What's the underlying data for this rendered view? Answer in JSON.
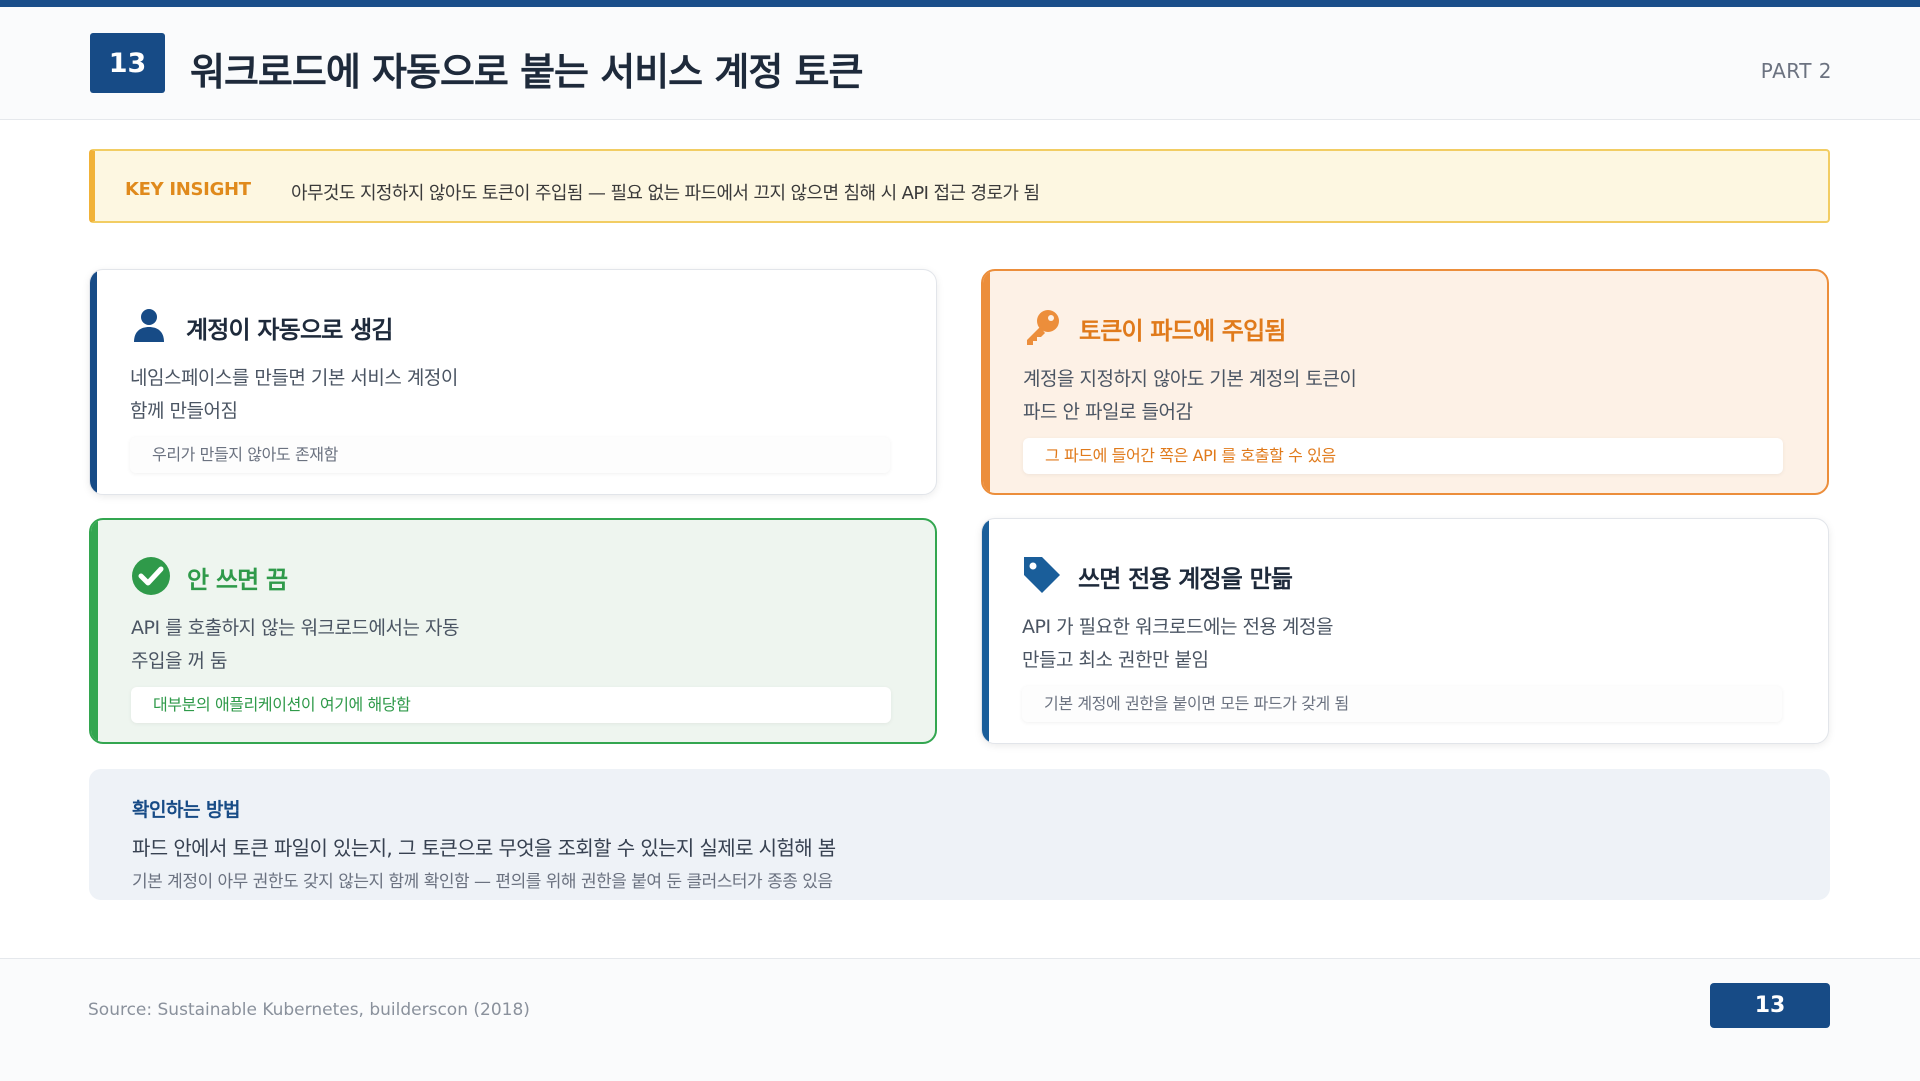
{
  "header": {
    "slide_number": "13",
    "title": "워크로드에 자동으로 붙는 서비스 계정 토큰",
    "part": "PART 2"
  },
  "insight": {
    "label": "KEY INSIGHT",
    "text": "아무것도 지정하지 않아도 토큰이 주입됨 — 필요 없는 파드에서 끄지 않으면 침해 시 API 접근 경로가 됨"
  },
  "cards": [
    {
      "icon": "user-icon",
      "title": "계정이 자동으로 생김",
      "desc_lines": [
        "네임스페이스를 만들면 기본 서비스 계정이",
        "함께 만들어짐"
      ],
      "note": "우리가 만들지 않아도 존재함",
      "accent": "#174b86"
    },
    {
      "icon": "key-icon",
      "title": "토큰이 파드에 주입됨",
      "desc_lines": [
        "계정을 지정하지 않아도 기본 계정의 토큰이",
        "파드 안 파일로 들어감"
      ],
      "note": "그 파드에 들어간 쪽은 API 를 호출할 수 있음",
      "accent": "#ec8e3b"
    },
    {
      "icon": "check-circle-icon",
      "title": "안 쓰면 끔",
      "desc_lines": [
        "API 를 호출하지 않는 워크로드에서는 자동",
        "주입을 꺼 둠"
      ],
      "note": "대부분의 애플리케이션이 여기에 해당함",
      "accent": "#33a650"
    },
    {
      "icon": "tag-icon",
      "title": "쓰면 전용 계정을 만듦",
      "desc_lines": [
        "API 가 필요한 워크로드에는 전용 계정을",
        "만들고 최소 권한만 붙임"
      ],
      "note": "기본 계정에 권한을 붙이면 모든 파드가 갖게 됨",
      "accent": "#1a5e9a"
    }
  ],
  "method": {
    "title": "확인하는 방법",
    "line1": "파드 안에서 토큰 파일이 있는지, 그 토큰으로 무엇을 조회할 수 있는지 실제로 시험해 봄",
    "line2": "기본 계정이 아무 권한도 갖지 않는지 함께 확인함 — 편의를 위해 권한을 붙여 둔 클러스터가 종종 있음"
  },
  "footer": {
    "source": "Source: Sustainable Kubernetes, builderscon (2018)",
    "page_number": "13"
  }
}
